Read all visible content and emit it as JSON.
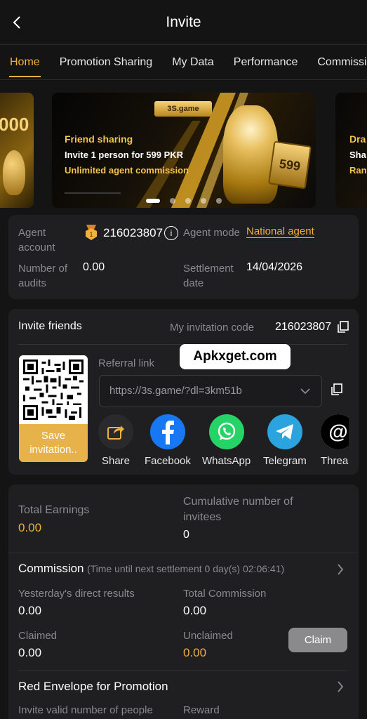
{
  "header": {
    "title": "Invite"
  },
  "tabs": [
    "Home",
    "Promotion Sharing",
    "My Data",
    "Performance",
    "Commission"
  ],
  "banner": {
    "left_partial": "000",
    "main": {
      "logo": "3S.game",
      "line1": "Friend sharing",
      "line2": "Invite 1 person for 599 PKR",
      "line3": "Unlimited agent commission",
      "badge": "599"
    },
    "right_partial": {
      "line1": "Dra",
      "line2": "Sha",
      "line3": "Ran"
    }
  },
  "agent": {
    "account_label": "Agent account",
    "account_value": "216023807",
    "mode_label": "Agent mode",
    "mode_value": "National agent",
    "audits_label": "Number of audits",
    "audits_value": "0.00",
    "settlement_label": "Settlement date",
    "settlement_value": "14/04/2026"
  },
  "invite": {
    "title": "Invite friends",
    "code_label": "My invitation code",
    "code_value": "216023807",
    "watermark": "Apkxget.com",
    "referral_label": "Referral link",
    "referral_value": "https://3s.game/?dl=3km51b",
    "save_label": "Save invitation..",
    "share_items": [
      {
        "name": "Share",
        "icon": "share-icon"
      },
      {
        "name": "Facebook",
        "icon": "facebook-icon"
      },
      {
        "name": "WhatsApp",
        "icon": "whatsapp-icon"
      },
      {
        "name": "Telegram",
        "icon": "telegram-icon"
      },
      {
        "name": "Threa",
        "icon": "threads-icon"
      }
    ]
  },
  "earnings": {
    "total_label": "Total Earnings",
    "total_value": "0.00",
    "invitees_label": "Cumulative number of invitees",
    "invitees_value": "0"
  },
  "commission": {
    "title": "Commission",
    "countdown": "(Time until next settlement  0 day(s) 02:06:41)",
    "yesterday_label": "Yesterday's direct results",
    "yesterday_value": "0.00",
    "total_label": "Total Commission",
    "total_value": "0.00",
    "claimed_label": "Claimed",
    "claimed_value": "0.00",
    "unclaimed_label": "Unclaimed",
    "unclaimed_value": "0.00",
    "claim_button": "Claim"
  },
  "red_envelope": {
    "title": "Red Envelope for Promotion",
    "col1": "Invite valid number of people",
    "col2": "Reward"
  },
  "colors": {
    "accent": "#f0b13d",
    "bg": "#141414",
    "panel": "#1f1f21"
  }
}
